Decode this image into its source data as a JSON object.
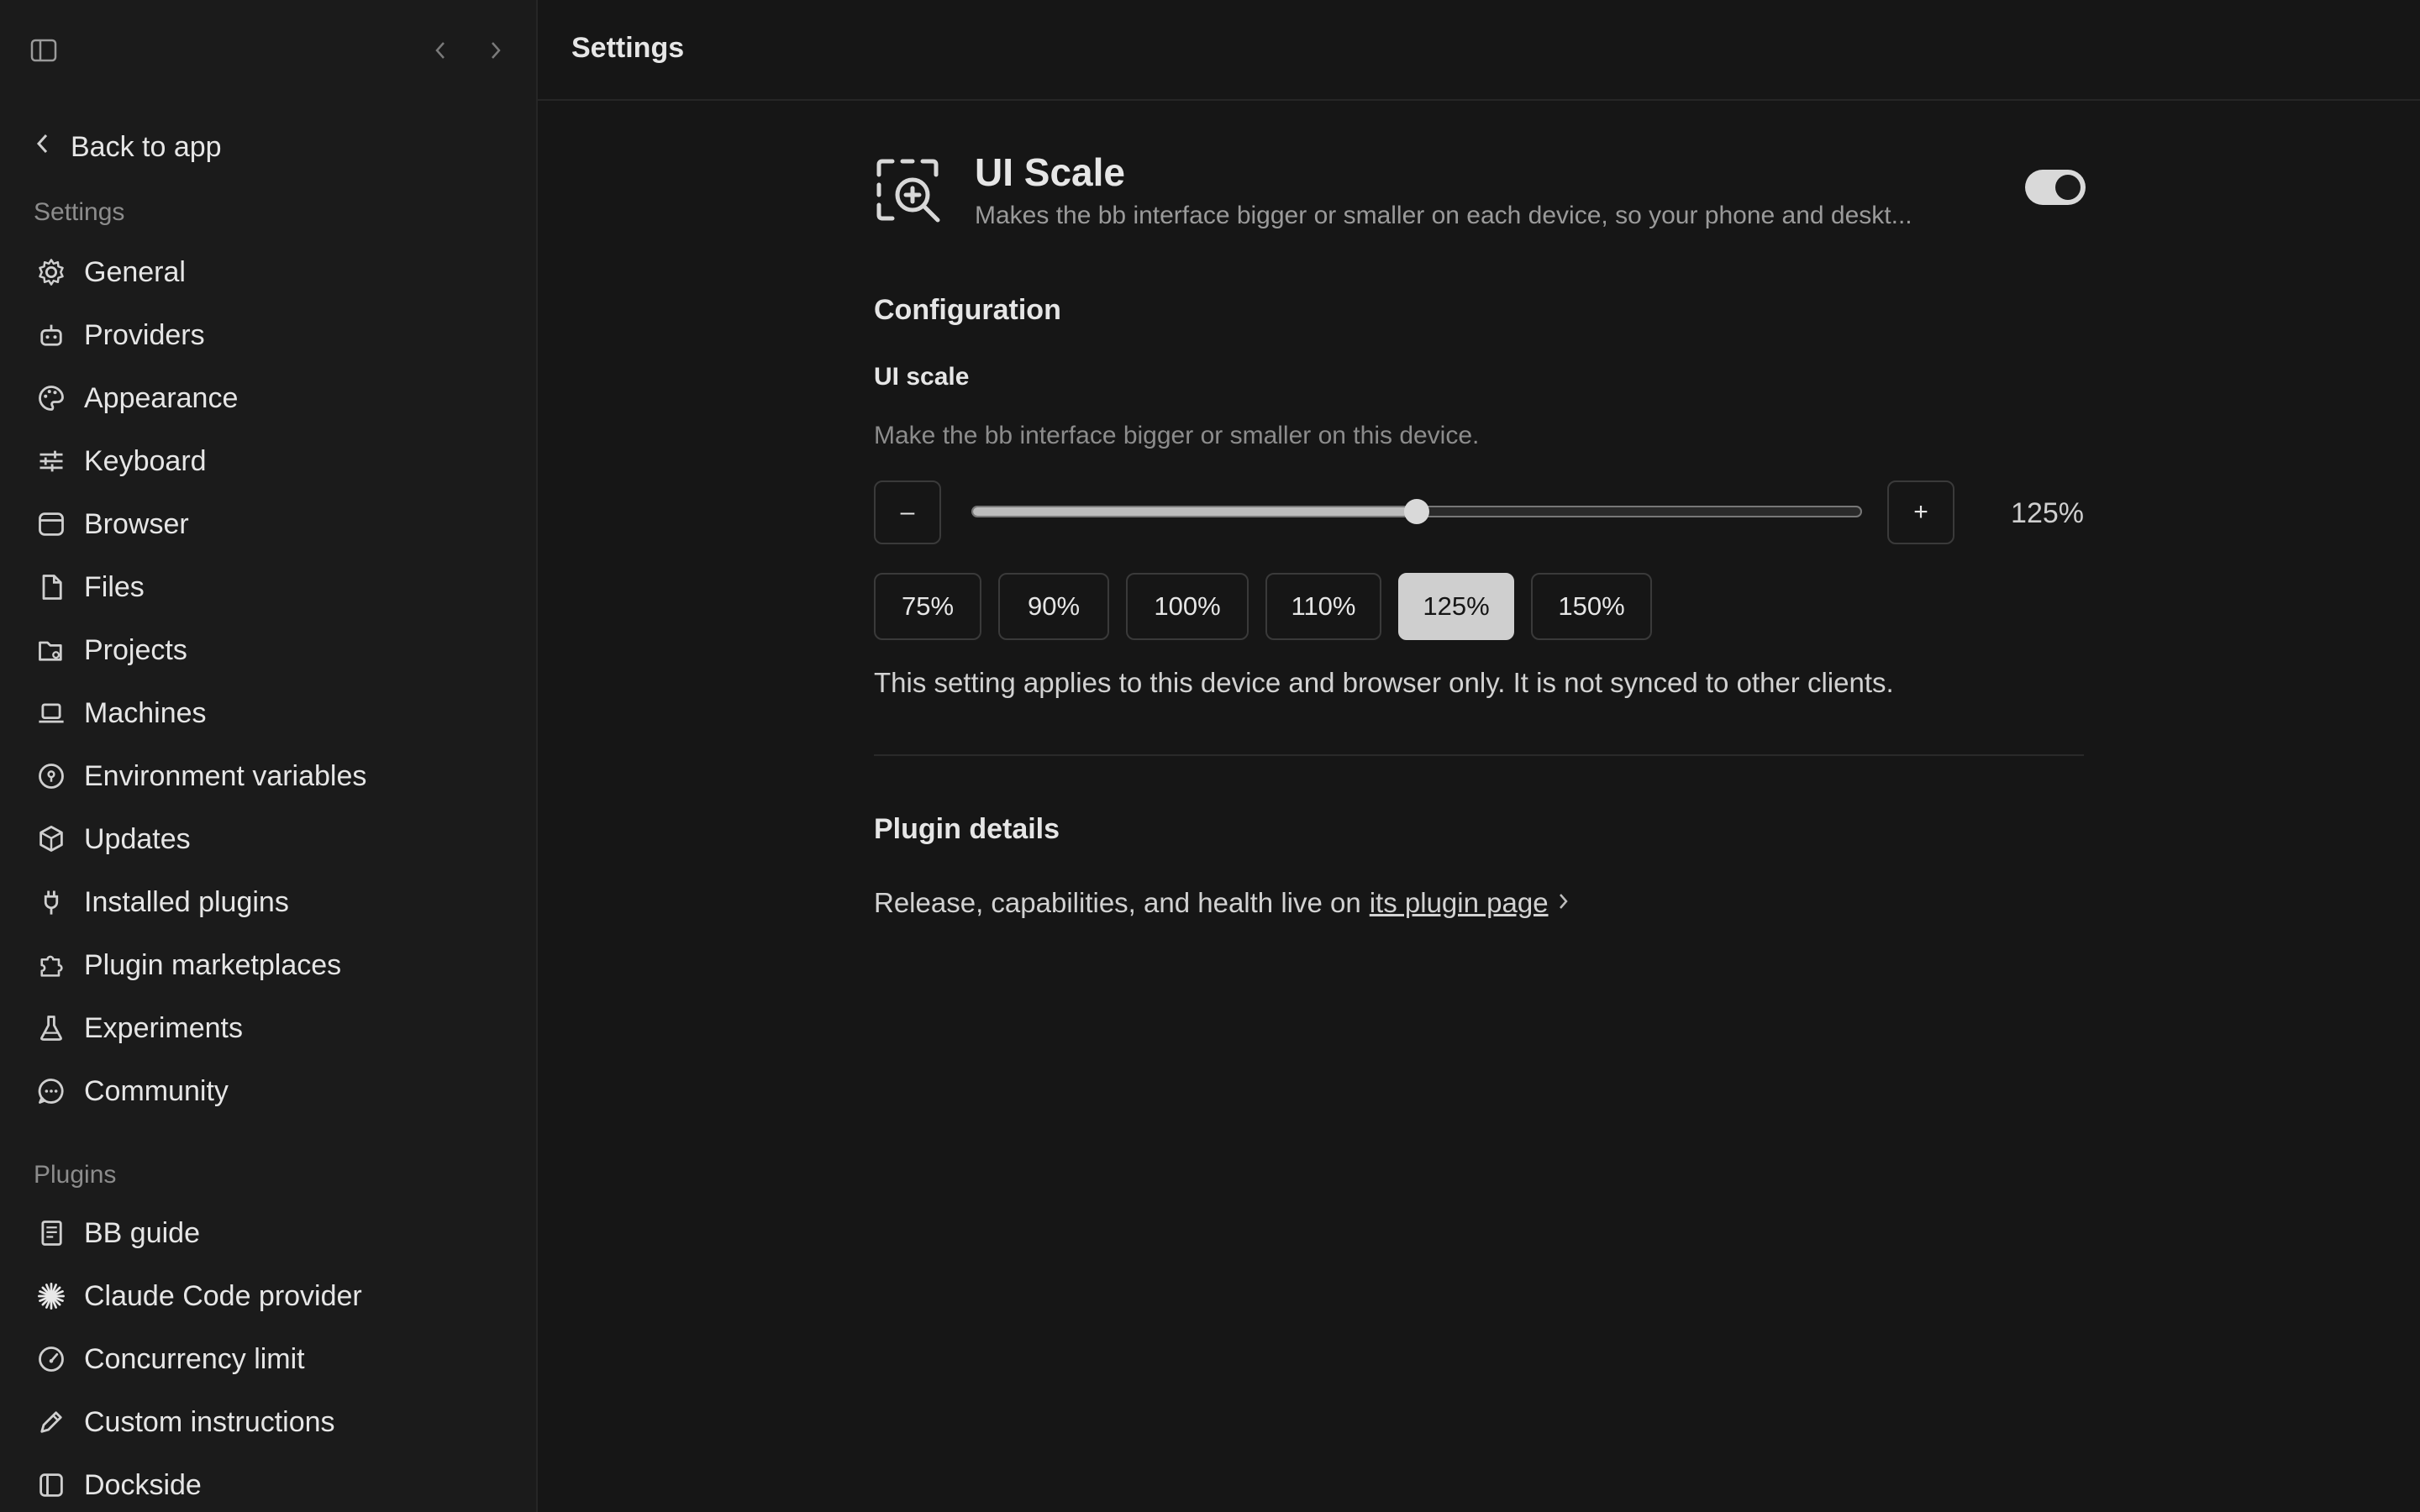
{
  "sidebar": {
    "back_label": "Back to app",
    "settings_heading": "Settings",
    "settings_items": [
      {
        "label": "General",
        "icon": "gear-icon"
      },
      {
        "label": "Providers",
        "icon": "bot-icon"
      },
      {
        "label": "Appearance",
        "icon": "palette-icon"
      },
      {
        "label": "Keyboard",
        "icon": "sliders-icon"
      },
      {
        "label": "Browser",
        "icon": "browser-icon"
      },
      {
        "label": "Files",
        "icon": "file-icon"
      },
      {
        "label": "Projects",
        "icon": "folder-icon"
      },
      {
        "label": "Machines",
        "icon": "laptop-icon"
      },
      {
        "label": "Environment variables",
        "icon": "pin-icon"
      },
      {
        "label": "Updates",
        "icon": "package-icon"
      },
      {
        "label": "Installed plugins",
        "icon": "plug-icon"
      },
      {
        "label": "Plugin marketplaces",
        "icon": "puzzle-icon"
      },
      {
        "label": "Experiments",
        "icon": "flask-icon"
      },
      {
        "label": "Community",
        "icon": "chat-icon"
      }
    ],
    "plugins_heading": "Plugins",
    "plugin_items": [
      {
        "label": "BB guide",
        "icon": "book-icon"
      },
      {
        "label": "Claude Code provider",
        "icon": "claude-burst-icon"
      },
      {
        "label": "Concurrency limit",
        "icon": "gauge-icon"
      },
      {
        "label": "Custom instructions",
        "icon": "pencil-icon"
      },
      {
        "label": "Dockside",
        "icon": "panel-icon"
      }
    ]
  },
  "header": {
    "title": "Settings"
  },
  "plugin": {
    "name": "UI Scale",
    "description": "Makes the bb interface bigger or smaller on each device, so your phone and deskt...",
    "enabled": true,
    "icon": "zoom-in-icon"
  },
  "configuration": {
    "heading": "Configuration",
    "field_label": "UI scale",
    "field_help": "Make the bb interface bigger or smaller on this device.",
    "decrement_label": "–",
    "increment_label": "+",
    "slider_fraction": 0.5,
    "value_text": "125%",
    "presets": [
      "75%",
      "90%",
      "100%",
      "110%",
      "125%",
      "150%"
    ],
    "active_preset": "125%",
    "note": "This setting applies to this device and browser only. It is not synced to other clients."
  },
  "details": {
    "heading": "Plugin details",
    "text": "Release, capabilities, and health live on",
    "link_text": "its plugin page"
  }
}
